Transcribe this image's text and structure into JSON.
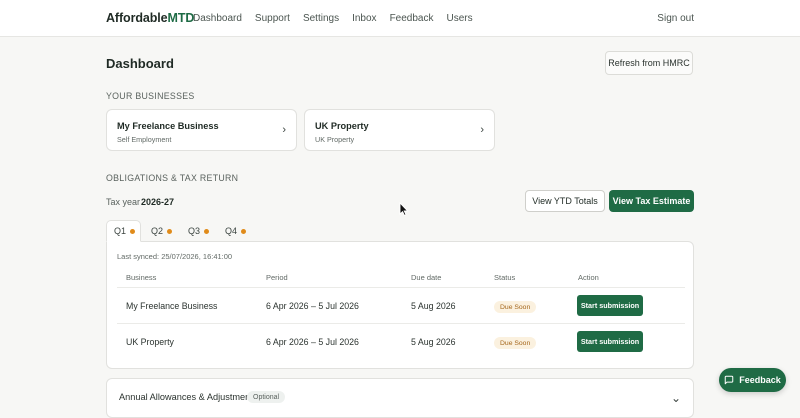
{
  "header": {
    "brand_main": "Affordable",
    "brand_accent": "MTD",
    "nav": [
      "Dashboard",
      "Support",
      "Settings",
      "Inbox",
      "Feedback",
      "Users"
    ],
    "sign_out": "Sign out"
  },
  "dashboard": {
    "title": "Dashboard",
    "refresh_label": "Refresh from HMRC"
  },
  "businesses": {
    "heading": "YOUR BUSINESSES",
    "items": [
      {
        "name": "My Freelance Business",
        "type": "Self Employment"
      },
      {
        "name": "UK Property",
        "type": "UK Property"
      }
    ]
  },
  "obligations": {
    "heading": "OBLIGATIONS & TAX RETURN",
    "tax_year_label": "Tax year",
    "tax_year_value": "2026-27",
    "ytd_label": "View YTD Totals",
    "estimate_label": "View Tax Estimate",
    "tabs": [
      "Q1",
      "Q2",
      "Q3",
      "Q4"
    ],
    "active_tab": "Q1",
    "last_synced": "Last synced: 25/07/2026, 16:41:00",
    "columns": [
      "Business",
      "Period",
      "Due date",
      "Status",
      "Action"
    ],
    "rows": [
      {
        "business": "My Freelance Business",
        "period": "6 Apr 2026 – 5 Jul 2026",
        "due": "5 Aug 2026",
        "status": "Due Soon",
        "action": "Start submission"
      },
      {
        "business": "UK Property",
        "period": "6 Apr 2026 – 5 Jul 2026",
        "due": "5 Aug 2026",
        "status": "Due Soon",
        "action": "Start submission"
      }
    ]
  },
  "annual": {
    "title": "Annual Allowances & Adjustments",
    "optional": "Optional"
  },
  "feedback_button": "Feedback",
  "colors": {
    "brand_green": "#1f6b45",
    "due_soon_bg": "#fbf1df",
    "due_soon_text": "#a4661b",
    "tab_dot": "#e08b1a"
  },
  "icons": {
    "card_chevron": "chevron-right-icon",
    "accordion": "chevron-down-icon",
    "feedback": "message-square-icon"
  }
}
